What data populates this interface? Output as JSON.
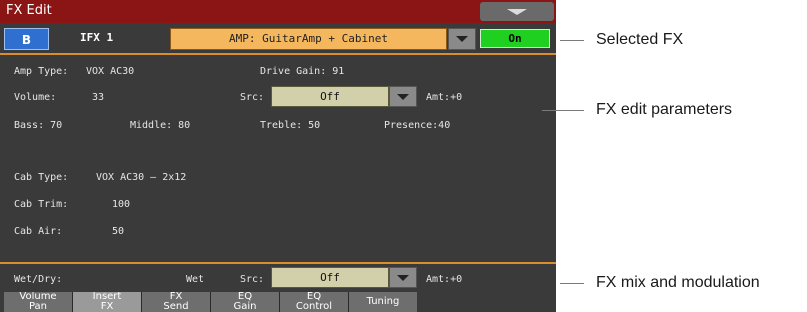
{
  "title": "FX Edit",
  "fx_row": {
    "bank": "B",
    "slot": "IFX 1",
    "selected_fx": "AMP: GuitarAmp + Cabinet",
    "on_label": "On"
  },
  "params": {
    "amp_type_label": "Amp Type:",
    "amp_type_value": "VOX AC30",
    "drive_gain": "Drive Gain: 91",
    "volume_label": "Volume:",
    "volume_value": "33",
    "src_label": "Src:",
    "src_value": "Off",
    "amt": "Amt:+0",
    "bass": "Bass: 70",
    "middle": "Middle: 80",
    "treble": "Treble: 50",
    "presence": "Presence:40",
    "cab_type_label": "Cab Type:",
    "cab_type_value": "VOX AC30 – 2x12",
    "cab_trim_label": "Cab Trim:",
    "cab_trim_value": "100",
    "cab_air_label": "Cab Air:",
    "cab_air_value": "50"
  },
  "mix": {
    "wet_dry_label": "Wet/Dry:",
    "wet_dry_value": "Wet",
    "src_label": "Src:",
    "src_value": "Off",
    "amt": "Amt:+0"
  },
  "tabs": [
    {
      "line1": "Volume",
      "line2": "Pan"
    },
    {
      "line1": "Insert",
      "line2": "FX"
    },
    {
      "line1": "FX",
      "line2": "Send"
    },
    {
      "line1": "EQ",
      "line2": "Gain"
    },
    {
      "line1": "EQ",
      "line2": "Control"
    },
    {
      "line1": "Tuning",
      "line2": ""
    }
  ],
  "callouts": {
    "selected_fx": "Selected FX",
    "edit_params": "FX edit parameters",
    "mix_mod": "FX mix and modulation"
  }
}
